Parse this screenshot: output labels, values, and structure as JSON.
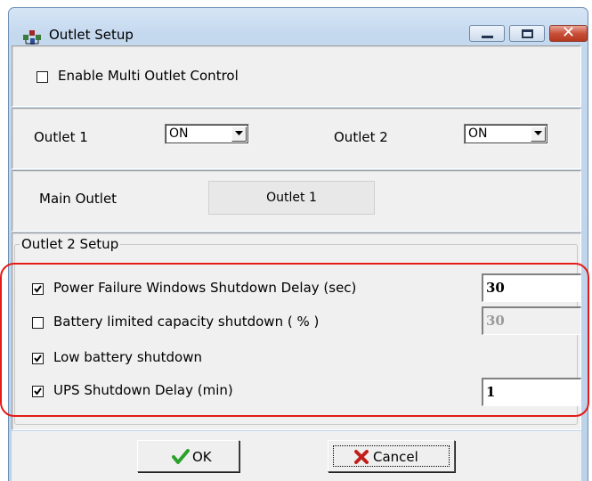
{
  "window": {
    "title": "Outlet Setup"
  },
  "multi_outlet": {
    "label": "Enable Multi Outlet Control",
    "checked": false
  },
  "outlets": {
    "outlet1_label": "Outlet 1",
    "outlet1_value": "ON",
    "outlet2_label": "Outlet 2",
    "outlet2_value": "ON"
  },
  "main_outlet": {
    "label": "Main Outlet",
    "button_label": "Outlet 1"
  },
  "outlet2_setup": {
    "group_label": "Outlet 2 Setup",
    "options": [
      {
        "label": "Power Failure Windows Shutdown Delay (sec)",
        "checked": true,
        "value": "30",
        "enabled": true
      },
      {
        "label": "Battery limited  capacity shutdown ( % )",
        "checked": false,
        "value": "30",
        "enabled": false
      },
      {
        "label": "Low battery shutdown",
        "checked": true
      },
      {
        "label": "UPS Shutdown Delay (min)",
        "checked": true,
        "value": "1",
        "enabled": true
      }
    ]
  },
  "buttons": {
    "ok_label": "OK",
    "cancel_label": "Cancel"
  },
  "colors": {
    "highlight": "#e41b17",
    "ok_check": "#2aa12a",
    "cancel_x": "#c0201a"
  },
  "icons": {
    "title": "network-outlet-icon",
    "ok": "checkmark-icon",
    "cancel": "x-icon"
  }
}
